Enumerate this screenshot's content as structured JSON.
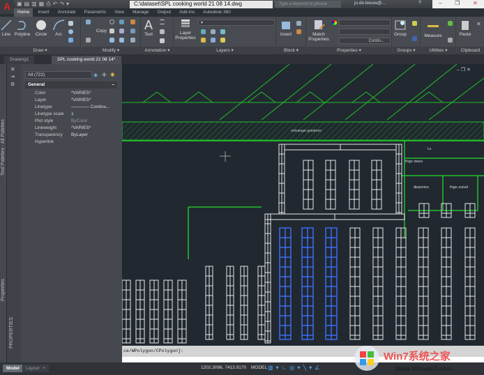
{
  "app": {
    "title": "C:\\dataset\\SPL cooking world 21 08 14.dwg",
    "app_button": "A",
    "search_placeholder": "Type a keyword or phrase",
    "user": "jo.de.leeuw@...",
    "help": "?",
    "window_controls": [
      "–",
      "❐",
      "✕"
    ]
  },
  "ribbon": {
    "tabs": [
      "Home",
      "Insert",
      "Annotate",
      "Parametric",
      "View",
      "Manage",
      "Output",
      "Add-ins",
      "Autodesk 360"
    ],
    "active_tab": "Home",
    "panels": {
      "draw": {
        "label": "Draw ▾",
        "tools": [
          "Line",
          "Polyline",
          "Circle",
          "Arc"
        ]
      },
      "modify": {
        "label": "Modify ▾",
        "copy": "Copy"
      },
      "annotation": {
        "label": "Annotation ▾",
        "text": "Text"
      },
      "layers": {
        "label": "Layers ▾",
        "layer_properties": "Layer Properties"
      },
      "block": {
        "label": "Block ▾",
        "insert": "Insert"
      },
      "properties": {
        "label": "Properties ▾",
        "match": "Match Properties",
        "linetype": "Contin..."
      },
      "groups": {
        "label": "Groups ▾",
        "group": "Group"
      },
      "utilities": {
        "label": "Utilities ▾",
        "measure": "Measure"
      },
      "clipboard": {
        "label": "Clipboard",
        "paste": "Paste"
      }
    }
  },
  "doc_tabs": [
    "Drawing1",
    "SPL cooking world 21 08 14*"
  ],
  "palettes": {
    "tool_palettes": "Tool Palettes - All Palettes",
    "properties_side": "Properties",
    "properties_caption": "PROPERTIES"
  },
  "properties": {
    "selection": "All (722)",
    "section": "General",
    "rows": [
      {
        "key": "Color",
        "value": "*VARIES*"
      },
      {
        "key": "Layer",
        "value": "*VARIES*"
      },
      {
        "key": "Linetype",
        "value": "———— Continu..."
      },
      {
        "key": "Linetype scale",
        "value": "1"
      },
      {
        "key": "Plot style",
        "value": "ByColor"
      },
      {
        "key": "Lineweight",
        "value": "*VARIES*"
      },
      {
        "key": "Transparency",
        "value": "ByLayer"
      },
      {
        "key": "Hyperlink",
        "value": ""
      }
    ]
  },
  "drawing": {
    "labels": [
      "ontvangst goederen",
      "frigo vlees",
      "diepvries",
      "frigo zuivel",
      "l.s."
    ],
    "colors": {
      "background": "#212830",
      "walls": "#22c02a",
      "racks": "#e8e8e8",
      "selected_racks": "#3a6cf0"
    }
  },
  "command_line": "ce/WPolygon/CPolygon]:",
  "status": {
    "layout_tabs": [
      "Model",
      "Layout1",
      "+"
    ],
    "coordinates": "1202.3096, 7413.9170",
    "space": "MODEL"
  },
  "watermark": {
    "text": "Win7系统之家",
    "url_text": "Www.Winwin7.com"
  }
}
